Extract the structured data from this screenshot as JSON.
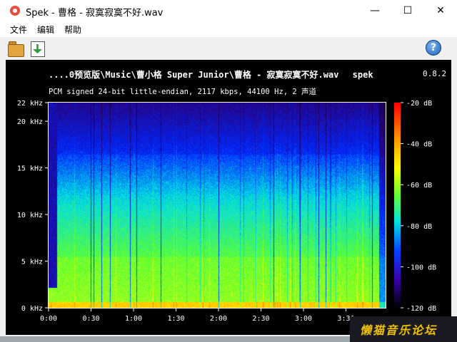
{
  "window": {
    "title": "Spek - 曹格 - 寂寞寂寞不好.wav",
    "minimize": "—",
    "maximize": "☐",
    "close": "✕"
  },
  "menu": {
    "items": [
      "文件",
      "编辑",
      "帮助"
    ]
  },
  "toolbar": {
    "open_icon": "folder-open-icon",
    "save_icon": "save-icon",
    "help_label": "?"
  },
  "spectrogram": {
    "file_path": "....0预览版\\Music\\曹小格  Super Junior\\曹格 - 寂寞寂寞不好.wav",
    "app_name": "spek",
    "version": "0.8.2",
    "info": "PCM signed 24-bit little-endian, 2117 kbps, 44100 Hz, 2 声道"
  },
  "chart_data": {
    "type": "heatmap",
    "x_axis": {
      "ticks": [
        "0:00",
        "0:30",
        "1:00",
        "1:30",
        "2:00",
        "2:30",
        "3:00",
        "3:30"
      ],
      "range_seconds": [
        0,
        238
      ]
    },
    "y_axis": {
      "ticks": [
        "0 kHz",
        "5 kHz",
        "10 kHz",
        "15 kHz",
        "20 kHz",
        "22 kHz"
      ],
      "range_khz": [
        0,
        22
      ]
    },
    "colorbar": {
      "ticks": [
        "-20 dB",
        "-40 dB",
        "-60 dB",
        "-80 dB",
        "-100 dB",
        "-120 dB"
      ],
      "range_db": [
        -120,
        -20
      ]
    }
  },
  "watermark": {
    "text": "懒猫音乐论坛"
  }
}
